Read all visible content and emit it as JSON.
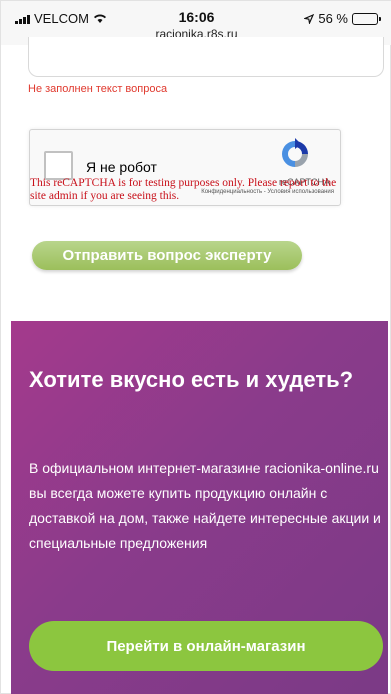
{
  "status_bar": {
    "carrier": "VELCOM",
    "time": "16:06",
    "url": "racionika.r8s.ru",
    "battery": "56 %",
    "battery_level": 0.56
  },
  "form": {
    "error_message": "Не заполнен текст вопроса",
    "captcha": {
      "checkbox_label": "Я не робот",
      "brand": "reCAPTCHA",
      "links": "Конфиденциальность - Условия использования",
      "warning": "This reCAPTCHA is for testing purposes only. Please report to the site admin if you are seeing this."
    },
    "submit_label": "Отправить вопрос эксперту"
  },
  "promo": {
    "title": "Хотите вкусно есть и худеть?",
    "text": "В официальном интернет-магазине racionika-online.ru вы всегда можете купить продукцию онлайн с доставкой на дом, также найдете интересные акции и специальные предложения",
    "button_label": "Перейти в онлайн-магазин"
  },
  "colors": {
    "error": "#e0392e",
    "submit": "#a8c872",
    "promo_bg": "#8a3b8b",
    "shop_button": "#8cc63f"
  }
}
